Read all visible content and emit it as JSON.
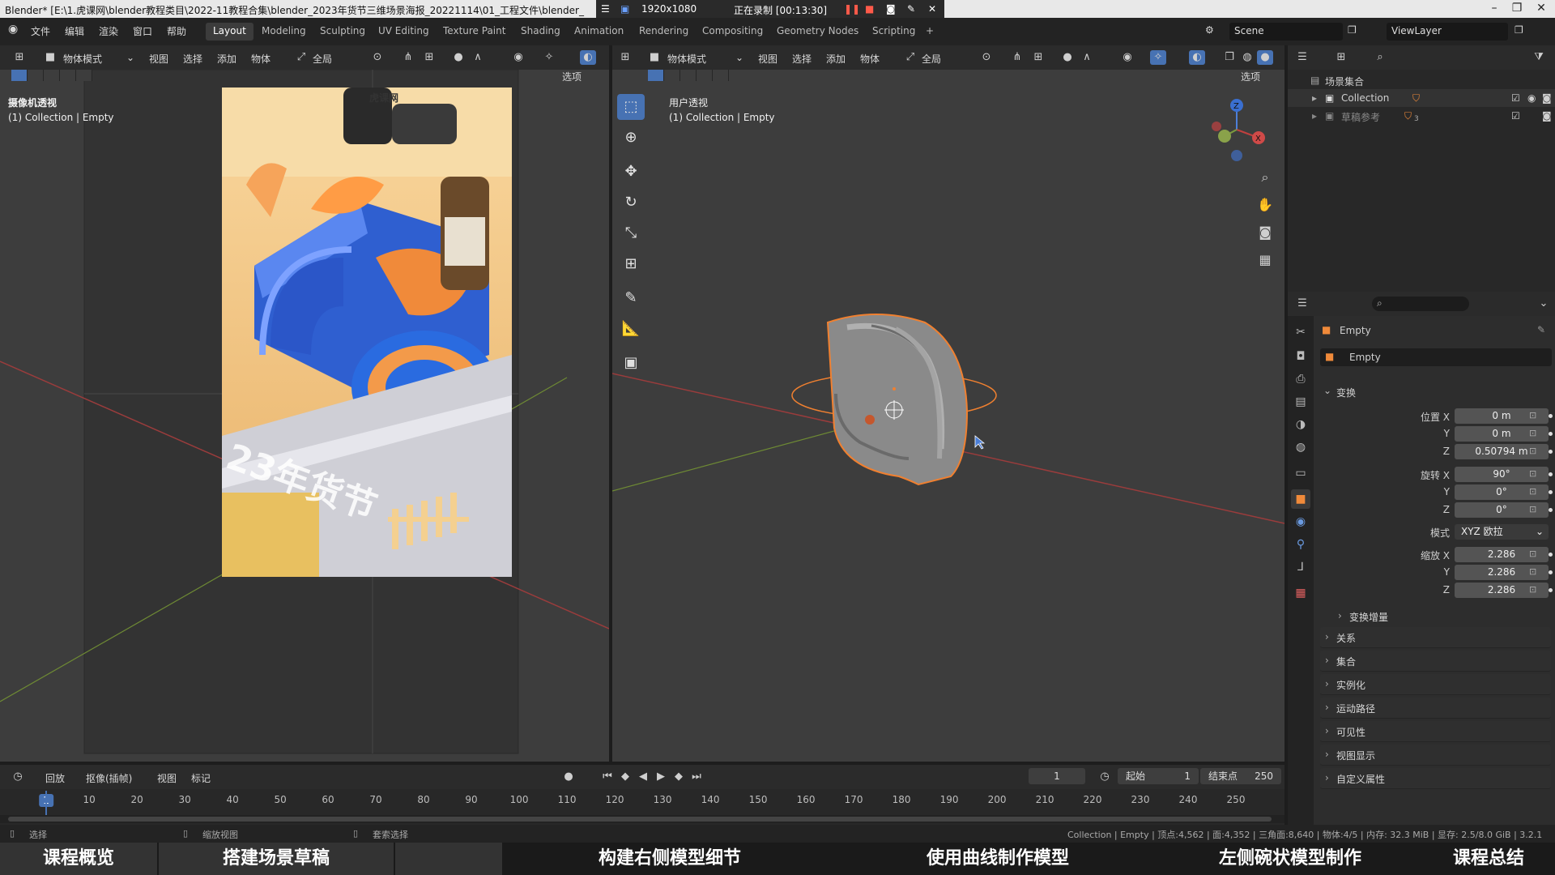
{
  "window": {
    "title": "Blender* [E:\\1.虎课网\\blender教程类目\\2022-11教程合集\\blender_2023年货节三维场景海报_20221114\\01_工程文件\\blender_",
    "resolution": "1920x1080",
    "recording": "正在录制 [00:13:30]"
  },
  "menu": {
    "items": [
      "文件",
      "编辑",
      "渲染",
      "窗口",
      "帮助"
    ],
    "workspaces": [
      "Layout",
      "Modeling",
      "Sculpting",
      "UV Editing",
      "Texture Paint",
      "Shading",
      "Animation",
      "Rendering",
      "Compositing",
      "Geometry Nodes",
      "Scripting"
    ],
    "active_workspace": "Layout",
    "add_tab": "+",
    "scene": "Scene",
    "view_layer": "ViewLayer"
  },
  "left_viewport": {
    "mode": "物体模式",
    "menus": [
      "视图",
      "选择",
      "添加",
      "物体"
    ],
    "orientation": "全局",
    "options": "选项",
    "view_name": "摄像机透视",
    "collection_label": "(1) Collection | Empty"
  },
  "mid_viewport": {
    "mode": "物体模式",
    "menus": [
      "视图",
      "选择",
      "添加",
      "物体"
    ],
    "orientation": "全局",
    "options": "选项",
    "view_name": "用户透视",
    "collection_label": "(1) Collection | Empty",
    "tools": [
      "select-tool-icon",
      "cursor-tool-icon",
      "move-tool-icon",
      "rotate-tool-icon",
      "scale-tool-icon",
      "transform-tool-icon",
      "annotate-tool-icon",
      "measure-tool-icon",
      "add-cube-tool-icon"
    ]
  },
  "poster": {
    "brand": "虎课网",
    "banner": "23年货节"
  },
  "outliner": {
    "root": "场景集合",
    "items": [
      {
        "name": "Collection",
        "count": ""
      },
      {
        "name": "草稿参考",
        "count": "3"
      }
    ]
  },
  "properties": {
    "object_name": "Empty",
    "data_name": "Empty",
    "section_transform": "变换",
    "location_label": "位置 X",
    "location": {
      "x": "0 m",
      "y": "0 m",
      "z": "0.50794 m"
    },
    "rotation_label": "旋转 X",
    "rotation": {
      "x": "90°",
      "y": "0°",
      "z": "0°"
    },
    "mode_label": "模式",
    "rotation_mode": "XYZ 欧拉",
    "scale_label": "缩放 X",
    "scale": {
      "x": "2.286",
      "y": "2.286",
      "z": "2.286"
    },
    "axis_y": "Y",
    "axis_z": "Z",
    "panels": [
      "变换增量",
      "关系",
      "集合",
      "实例化",
      "运动路径",
      "可见性",
      "视图显示",
      "自定义属性"
    ]
  },
  "timeline": {
    "menus": [
      "回放",
      "抠像(插帧)",
      "视图",
      "标记"
    ],
    "ticks": [
      "1",
      "10",
      "20",
      "30",
      "40",
      "50",
      "60",
      "70",
      "80",
      "90",
      "100",
      "110",
      "120",
      "130",
      "140",
      "150",
      "160",
      "170",
      "180",
      "190",
      "200",
      "210",
      "220",
      "230",
      "240",
      "250"
    ],
    "current_frame": "1",
    "start_label": "起始",
    "start": "1",
    "end_label": "结束点",
    "end": "250"
  },
  "status": {
    "select": "选择",
    "zoom": "缩放视图",
    "lasso": "套索选择",
    "stats": "Collection | Empty | 顶点:4,562 | 面:4,352 | 三角面:8,640 | 物体:4/5 | 内存: 32.3 MiB | 显存: 2.5/8.0 GiB | 3.2.1"
  },
  "chapters": [
    "课程概览",
    "搭建场景草稿",
    "",
    "构建右侧模型细节",
    "使用曲线制作模型",
    "左侧碗状模型制作",
    "课程总结"
  ],
  "colors": {
    "accent": "#4772b3",
    "selection_outline": "#f08030",
    "viewport_bg": "#3d3d3d",
    "x_axis": "#b84a4a",
    "y_axis": "#7a9a3a"
  }
}
